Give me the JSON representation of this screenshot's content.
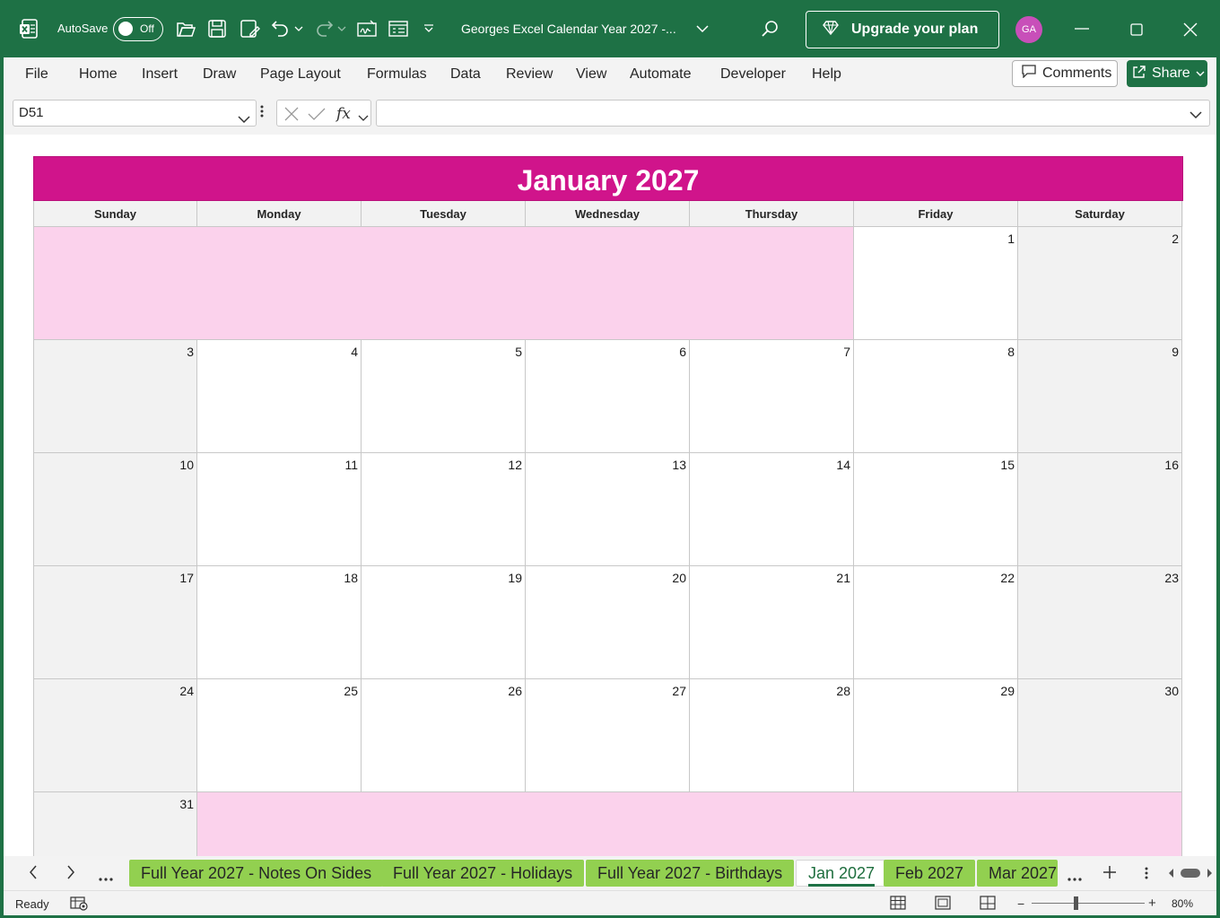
{
  "titlebar": {
    "autosave_label": "AutoSave",
    "autosave_state": "Off",
    "document_title": "Georges Excel Calendar Year 2027 -...",
    "upgrade_label": "Upgrade your plan",
    "avatar_initials": "GA"
  },
  "ribbon": {
    "tabs": [
      "File",
      "Home",
      "Insert",
      "Draw",
      "Page Layout",
      "Formulas",
      "Data",
      "Review",
      "View",
      "Automate",
      "Developer",
      "Help"
    ],
    "comments_label": "Comments",
    "share_label": "Share"
  },
  "formula_bar": {
    "name_box": "D51",
    "formula": ""
  },
  "calendar": {
    "title": "January 2027",
    "day_names": [
      "Sunday",
      "Monday",
      "Tuesday",
      "Wednesday",
      "Thursday",
      "Friday",
      "Saturday"
    ],
    "weeks": [
      [
        "",
        "",
        "",
        "",
        "",
        "1",
        "2"
      ],
      [
        "3",
        "4",
        "5",
        "6",
        "7",
        "8",
        "9"
      ],
      [
        "10",
        "11",
        "12",
        "13",
        "14",
        "15",
        "16"
      ],
      [
        "17",
        "18",
        "19",
        "20",
        "21",
        "22",
        "23"
      ],
      [
        "24",
        "25",
        "26",
        "27",
        "28",
        "29",
        "30"
      ],
      [
        "31",
        "",
        "",
        "",
        "",
        "",
        ""
      ]
    ],
    "colors": {
      "header": "#d0148b",
      "blank_fill": "#fbd2ec",
      "weekend_fill": "#f2f2f2"
    }
  },
  "sheet_tabs": {
    "tabs": [
      "Full Year 2027 - Notes On Sides",
      "Full Year 2027 - Holidays",
      "Full Year 2027 - Birthdays",
      "Jan 2027",
      "Feb 2027",
      "Mar 2027"
    ],
    "active": "Jan 2027",
    "tab_color": "#92d050"
  },
  "status_bar": {
    "status": "Ready",
    "zoom": "80%"
  },
  "theme": {
    "excel_green": "#1e7145"
  }
}
